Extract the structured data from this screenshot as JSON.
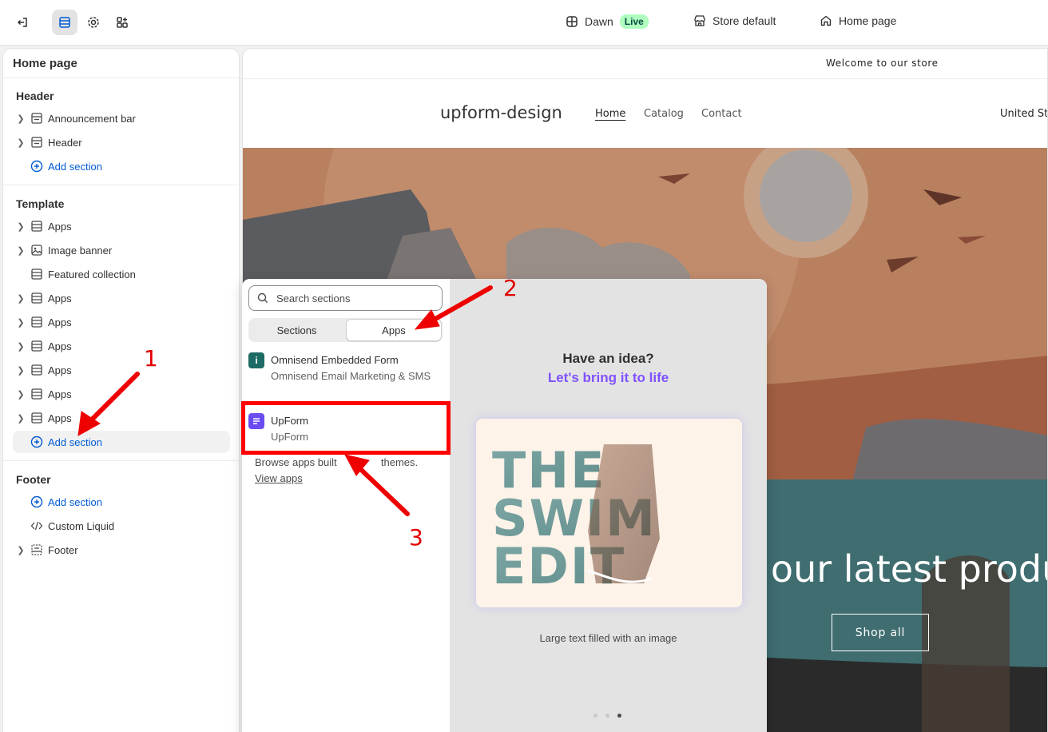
{
  "topbar": {
    "theme_name": "Dawn",
    "live_badge": "Live",
    "store_label": "Store default",
    "page_label": "Home page"
  },
  "sidebar": {
    "title": "Home page",
    "header_group": "Header",
    "header_items": [
      "Announcement bar",
      "Header"
    ],
    "add_section": "Add section",
    "template_group": "Template",
    "template_items": [
      "Apps",
      "Image banner",
      "Featured collection",
      "Apps",
      "Apps",
      "Apps",
      "Apps",
      "Apps",
      "Apps"
    ],
    "footer_group": "Footer",
    "footer_items": [
      "Custom Liquid",
      "Footer"
    ]
  },
  "preview": {
    "announcement": "Welcome to our store",
    "store_name": "upform-design",
    "nav": [
      "Home",
      "Catalog",
      "Contact"
    ],
    "locale": "United Sta",
    "banner_text": "e our latest produ",
    "shop_button": "Shop all"
  },
  "popover": {
    "search_placeholder": "Search sections",
    "tabs": [
      "Sections",
      "Apps"
    ],
    "apps": [
      {
        "title": "Omnisend Embedded Form",
        "subtitle": "Omnisend Email Marketing & SMS"
      },
      {
        "title": "UpForm",
        "subtitle": "UpForm"
      }
    ],
    "browse_text": "Browse apps built",
    "browse_text_tail": "themes.",
    "browse_link": "View apps",
    "promo_line1": "Have an idea?",
    "promo_line2": "Let's bring it to life",
    "card_lines": [
      "THE",
      "SWIM",
      "EDIT"
    ],
    "card_caption": "Large text filled with an image"
  },
  "annotations": [
    "1",
    "2",
    "3"
  ],
  "colors": {
    "accent_blue": "#005bd3",
    "live_green": "#affebf",
    "promo_purple": "#8051ff",
    "annotation_red": "#ff0000"
  }
}
